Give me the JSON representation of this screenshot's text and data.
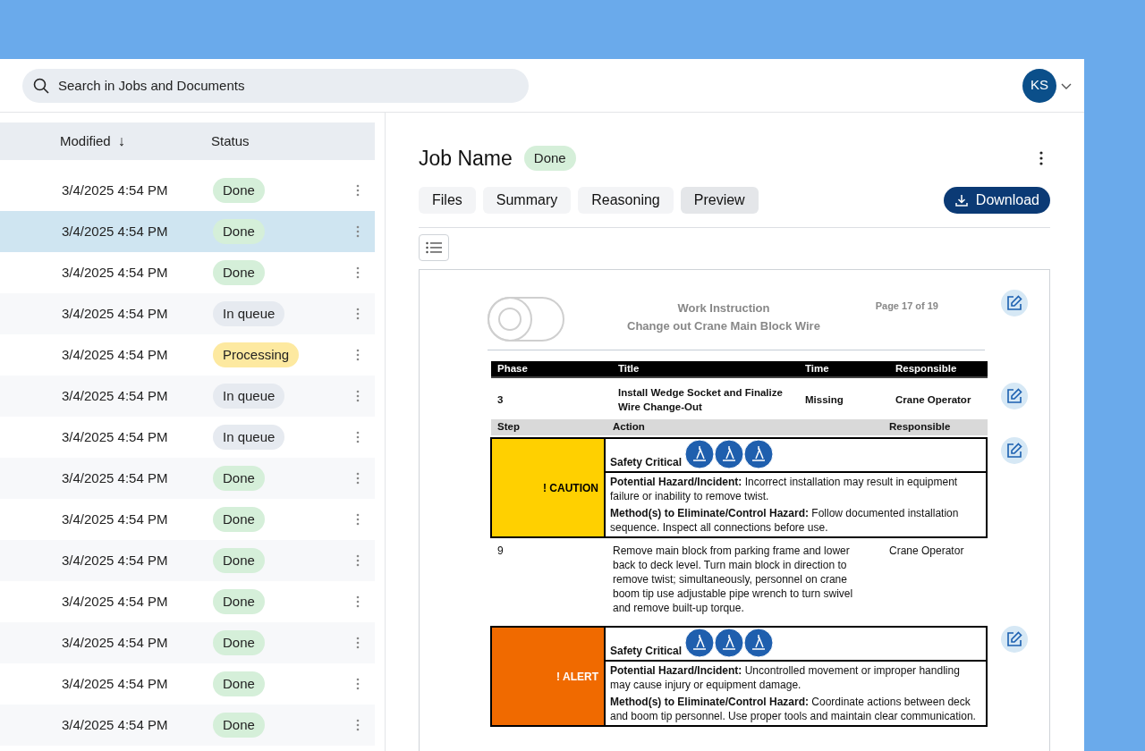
{
  "search": {
    "placeholder": "Search in Jobs and Documents"
  },
  "user": {
    "initials": "KS"
  },
  "table": {
    "columns": [
      {
        "label": "Modified",
        "sort_icon": "↓"
      },
      {
        "label": "Status"
      }
    ],
    "rows": [
      {
        "modified": "3/4/2025 4:54 PM",
        "status": "Done",
        "kind": "done",
        "selected": false
      },
      {
        "modified": "3/4/2025 4:54 PM",
        "status": "Done",
        "kind": "done",
        "selected": true
      },
      {
        "modified": "3/4/2025 4:54 PM",
        "status": "Done",
        "kind": "done",
        "selected": false
      },
      {
        "modified": "3/4/2025 4:54 PM",
        "status": "In queue",
        "kind": "queue",
        "selected": false
      },
      {
        "modified": "3/4/2025 4:54 PM",
        "status": "Processing",
        "kind": "processing",
        "selected": false
      },
      {
        "modified": "3/4/2025 4:54 PM",
        "status": "In queue",
        "kind": "queue",
        "selected": false
      },
      {
        "modified": "3/4/2025 4:54 PM",
        "status": "In queue",
        "kind": "queue",
        "selected": false
      },
      {
        "modified": "3/4/2025 4:54 PM",
        "status": "Done",
        "kind": "done",
        "selected": false
      },
      {
        "modified": "3/4/2025 4:54 PM",
        "status": "Done",
        "kind": "done",
        "selected": false
      },
      {
        "modified": "3/4/2025 4:54 PM",
        "status": "Done",
        "kind": "done",
        "selected": false
      },
      {
        "modified": "3/4/2025 4:54 PM",
        "status": "Done",
        "kind": "done",
        "selected": false
      },
      {
        "modified": "3/4/2025 4:54 PM",
        "status": "Done",
        "kind": "done",
        "selected": false
      },
      {
        "modified": "3/4/2025 4:54 PM",
        "status": "Done",
        "kind": "done",
        "selected": false
      },
      {
        "modified": "3/4/2025 4:54 PM",
        "status": "Done",
        "kind": "done",
        "selected": false
      }
    ]
  },
  "job": {
    "title": "Job Name",
    "status": "Done",
    "tabs": [
      {
        "label": "Files",
        "selected": false
      },
      {
        "label": "Summary",
        "selected": false
      },
      {
        "label": "Reasoning",
        "selected": false
      },
      {
        "label": "Preview",
        "selected": true
      }
    ],
    "download": "Download",
    "document": {
      "title": "Work Instruction",
      "subtitle": "Change out Crane Main Block Wire",
      "page": "Page 17 of 19",
      "phase_columns": [
        "Phase",
        "Title",
        "Time",
        "Responsible"
      ],
      "phase": {
        "phase": "3",
        "title": "Install Wedge Socket and Finalize Wire Change-Out",
        "time": "Missing",
        "responsible": "Crane Operator"
      },
      "step_columns": [
        "Step",
        "Action",
        "Responsible"
      ],
      "blocks": [
        {
          "kind": "hazard",
          "label": "! CAUTION",
          "color": "#ffd000",
          "heading": "Safety Critical",
          "hazard": "**Potential Hazard/Incident:** Incorrect installation may result in equipment failure or inability to remove twist.",
          "method": "**Method(s) to Eliminate/Control Hazard:** Follow documented installation sequence. Inspect all connections before use."
        },
        {
          "kind": "step",
          "step": "9",
          "action": "Remove main block from parking frame and lower back to deck level. Turn main block in direction to remove twist; simultaneously, personnel on crane boom tip use adjustable pipe wrench to turn swivel and remove built-up torque.",
          "responsible": "Crane Operator"
        },
        {
          "kind": "hazard",
          "label": "! ALERT",
          "color": "#f06a00",
          "heading": "Safety Critical",
          "hazard": "**Potential Hazard/Incident:** Uncontrolled movement or improper handling may cause injury or equipment damage.",
          "method": "**Method(s) to Eliminate/Control Hazard:** Coordinate actions between deck and boom tip personnel. Use proper tools and maintain clear communication."
        }
      ]
    }
  }
}
